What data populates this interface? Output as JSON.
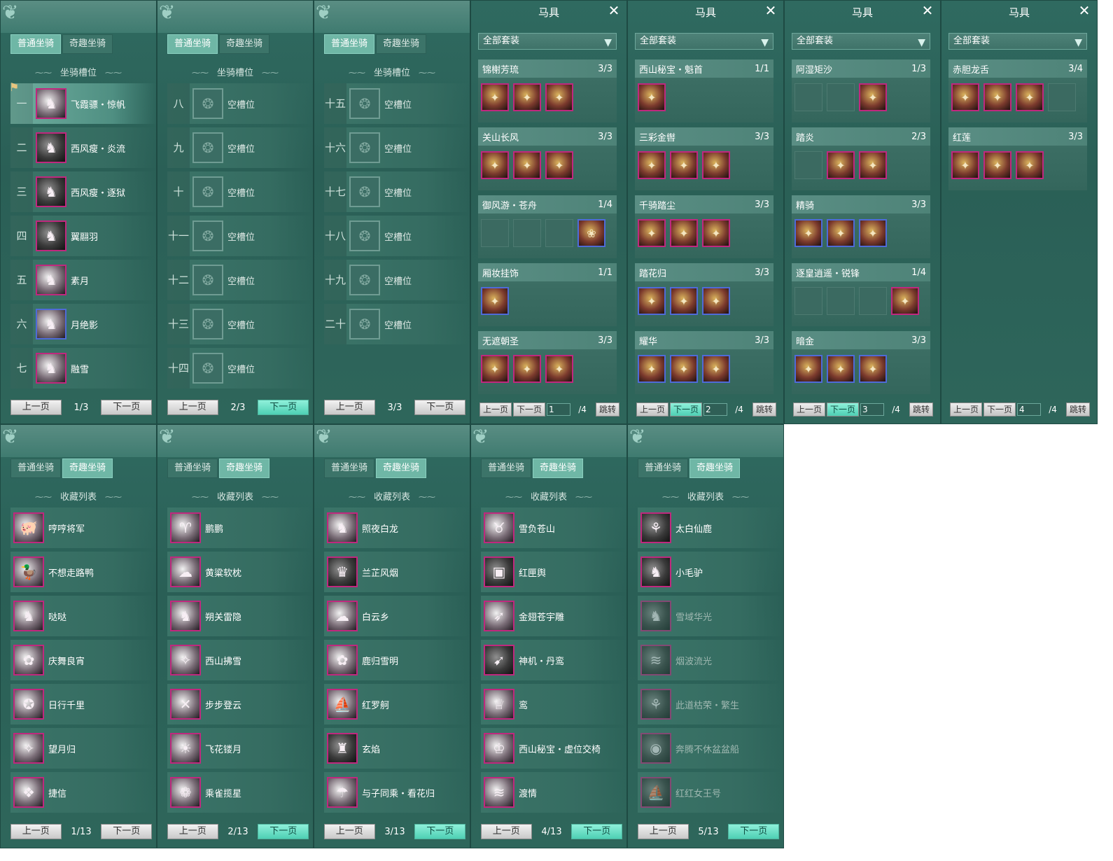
{
  "tabs": {
    "normal": "普通坐骑",
    "fun": "奇趣坐骑"
  },
  "slot_title": "坐骑槽位",
  "collection_title": "收藏列表",
  "pager": {
    "prev": "上一页",
    "next": "下一页",
    "jump": "跳转"
  },
  "empty_label": "空槽位",
  "slot_panels": [
    {
      "page": "1/3",
      "slots": [
        {
          "num": "一",
          "name": "飞霞骠・惊帆",
          "state": "filled"
        },
        {
          "num": "二",
          "name": "西风瘦・炎流",
          "state": "filled"
        },
        {
          "num": "三",
          "name": "西风瘦・逐狱",
          "state": "filled"
        },
        {
          "num": "四",
          "name": "翼翮羽",
          "state": "filled"
        },
        {
          "num": "五",
          "name": "素月",
          "state": "filled"
        },
        {
          "num": "六",
          "name": "月绝影",
          "state": "filled"
        },
        {
          "num": "七",
          "name": "融雪",
          "state": "filled"
        }
      ]
    },
    {
      "page": "2/3",
      "slots": [
        {
          "num": "八",
          "name": "空槽位",
          "state": "empty"
        },
        {
          "num": "九",
          "name": "空槽位",
          "state": "empty"
        },
        {
          "num": "十",
          "name": "空槽位",
          "state": "empty"
        },
        {
          "num": "十一",
          "name": "空槽位",
          "state": "empty"
        },
        {
          "num": "十二",
          "name": "空槽位",
          "state": "empty"
        },
        {
          "num": "十三",
          "name": "空槽位",
          "state": "empty"
        },
        {
          "num": "十四",
          "name": "空槽位",
          "state": "empty"
        }
      ]
    },
    {
      "page": "3/3",
      "slots": [
        {
          "num": "十五",
          "name": "空槽位",
          "state": "empty"
        },
        {
          "num": "十六",
          "name": "空槽位",
          "state": "empty"
        },
        {
          "num": "十七",
          "name": "空槽位",
          "state": "empty"
        },
        {
          "num": "十八",
          "name": "空槽位",
          "state": "empty"
        },
        {
          "num": "十九",
          "name": "空槽位",
          "state": "empty"
        },
        {
          "num": "二十",
          "name": "空槽位",
          "state": "empty"
        }
      ]
    }
  ],
  "saddle": {
    "title": "马具",
    "filter": "全部套装",
    "panels": [
      {
        "page_input": "1",
        "page_total": "/4",
        "sets": [
          {
            "name": "锦榭芳琉",
            "count": "3/3",
            "items": [
              "p",
              "p",
              "p"
            ]
          },
          {
            "name": "关山长风",
            "count": "3/3",
            "items": [
              "p",
              "p",
              "p"
            ]
          },
          {
            "name": "御风游・苍舟",
            "count": "1/4",
            "items": [
              "e",
              "e",
              "e",
              "b"
            ]
          },
          {
            "name": "厢妆挂饰",
            "count": "1/1",
            "items": [
              "b"
            ]
          },
          {
            "name": "无遮朝圣",
            "count": "3/3",
            "items": [
              "p",
              "p",
              "p"
            ]
          }
        ]
      },
      {
        "page_input": "2",
        "page_total": "/4",
        "sets": [
          {
            "name": "西山秘宝・魁首",
            "count": "1/1",
            "items": [
              "p"
            ]
          },
          {
            "name": "三彩金辔",
            "count": "3/3",
            "items": [
              "p",
              "p",
              "p"
            ]
          },
          {
            "name": "千骑踏尘",
            "count": "3/3",
            "items": [
              "p",
              "p",
              "p"
            ]
          },
          {
            "name": "踏花归",
            "count": "3/3",
            "items": [
              "b",
              "b",
              "b"
            ]
          },
          {
            "name": "耀华",
            "count": "3/3",
            "items": [
              "b",
              "b",
              "b"
            ]
          }
        ]
      },
      {
        "page_input": "3",
        "page_total": "/4",
        "sets": [
          {
            "name": "阿湿矩沙",
            "count": "1/3",
            "items": [
              "e",
              "e",
              "p"
            ]
          },
          {
            "name": "踏炎",
            "count": "2/3",
            "items": [
              "e",
              "p",
              "p"
            ]
          },
          {
            "name": "精骑",
            "count": "3/3",
            "items": [
              "b",
              "b",
              "b"
            ]
          },
          {
            "name": "逐皇逍遥・锐锋",
            "count": "1/4",
            "items": [
              "e",
              "e",
              "e",
              "p"
            ]
          },
          {
            "name": "暗金",
            "count": "3/3",
            "items": [
              "b",
              "b",
              "b"
            ]
          }
        ]
      },
      {
        "page_input": "4",
        "page_total": "/4",
        "sets": [
          {
            "name": "赤胆龙舌",
            "count": "3/4",
            "items": [
              "p",
              "p",
              "p",
              "e"
            ]
          },
          {
            "name": "红莲",
            "count": "3/3",
            "items": [
              "p",
              "p",
              "p"
            ]
          }
        ]
      }
    ]
  },
  "collection_panels": [
    {
      "page": "1/13",
      "items": [
        {
          "name": "哼哼将军",
          "dim": false
        },
        {
          "name": "不想走路鸭",
          "dim": false
        },
        {
          "name": "哒哒",
          "dim": false
        },
        {
          "name": "庆舞良宵",
          "dim": false
        },
        {
          "name": "日行千里",
          "dim": false
        },
        {
          "name": "望月归",
          "dim": false
        },
        {
          "name": "捷信",
          "dim": false
        }
      ]
    },
    {
      "page": "2/13",
      "items": [
        {
          "name": "鹏鹏",
          "dim": false
        },
        {
          "name": "黄粱软枕",
          "dim": false
        },
        {
          "name": "朔关雷隐",
          "dim": false
        },
        {
          "name": "西山拂雪",
          "dim": false
        },
        {
          "name": "步步登云",
          "dim": false
        },
        {
          "name": "飞花镂月",
          "dim": false
        },
        {
          "name": "乘雀揽星",
          "dim": false
        }
      ]
    },
    {
      "page": "3/13",
      "items": [
        {
          "name": "照夜白龙",
          "dim": false
        },
        {
          "name": "兰芷风烟",
          "dim": false
        },
        {
          "name": "白云乡",
          "dim": false
        },
        {
          "name": "鹿归雪明",
          "dim": false
        },
        {
          "name": "红罗舸",
          "dim": false
        },
        {
          "name": "玄焰",
          "dim": false
        },
        {
          "name": "与子同乘・看花归",
          "dim": false
        }
      ]
    },
    {
      "page": "4/13",
      "items": [
        {
          "name": "雪负苍山",
          "dim": false
        },
        {
          "name": "红匣舆",
          "dim": false
        },
        {
          "name": "金翅苍宇雕",
          "dim": false
        },
        {
          "name": "神机・丹鸾",
          "dim": false
        },
        {
          "name": "鸾",
          "dim": false
        },
        {
          "name": "西山秘宝・虚位交椅",
          "dim": false
        },
        {
          "name": "渡情",
          "dim": false
        }
      ]
    },
    {
      "page": "5/13",
      "items": [
        {
          "name": "太白仙鹿",
          "dim": false
        },
        {
          "name": "小毛驴",
          "dim": false
        },
        {
          "name": "雪域华光",
          "dim": true
        },
        {
          "name": "烟波流光",
          "dim": true
        },
        {
          "name": "此道枯荣・繁生",
          "dim": true
        },
        {
          "name": "奔腾不休盆盆船",
          "dim": true
        },
        {
          "name": "红红女王号",
          "dim": true
        }
      ]
    }
  ]
}
